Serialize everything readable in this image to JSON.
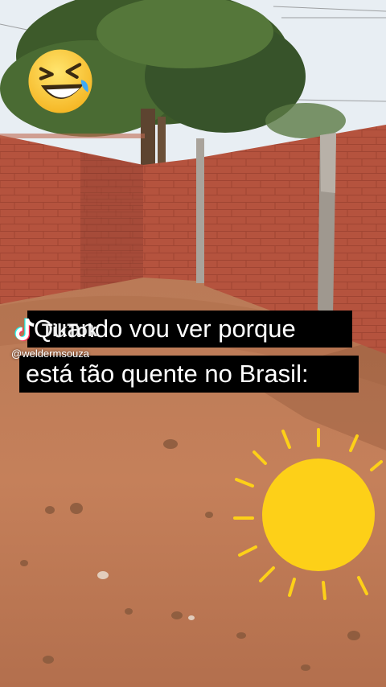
{
  "overlay": {
    "caption_line1": "Quando vou ver porque",
    "caption_line2": "está tão quente no Brasil:",
    "watermark_brand": "TikTok",
    "watermark_user": "@weldermsouza"
  },
  "stickers": {
    "emoji": "laughing-tears-emoji",
    "sun": "sun-drawing"
  },
  "colors": {
    "brick": "#b4503c",
    "soil": "#c07a55",
    "sky": "#e9eef2",
    "sun": "#fdd018",
    "caption_bg": "#000000",
    "caption_text": "#ffffff"
  }
}
